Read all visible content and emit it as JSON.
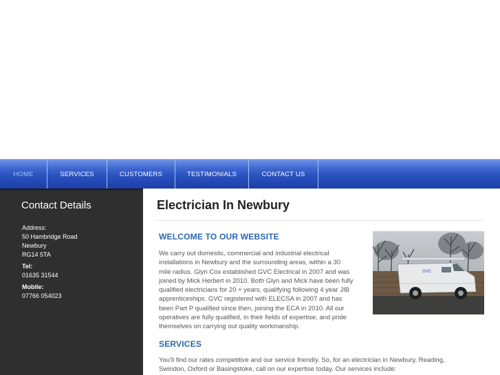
{
  "nav": {
    "items": [
      {
        "label": "HOME",
        "active": true
      },
      {
        "label": "SERVICES",
        "active": false
      },
      {
        "label": "CUSTOMERS",
        "active": false
      },
      {
        "label": "TESTIMONIALS",
        "active": false
      },
      {
        "label": "CONTACT US",
        "active": false
      }
    ]
  },
  "sidebar": {
    "title": "Contact Details",
    "address_label": "Address:",
    "address_lines": [
      "50 Hambridge Road",
      "Newbury",
      "RG14 5TA"
    ],
    "tel_label": "Tel:",
    "tel": "01635 31544",
    "mobile_label": "Mobile:",
    "mobile": "07766 054023"
  },
  "main": {
    "title": "Electrician In Newbury",
    "welcome_heading": "WELCOME TO OUR WEBSITE",
    "welcome_lines": [
      "We carry out domestic, commercial and industrial electrical",
      "installations in Newbury and the surrounding areas, within a 30",
      "mile radius. Glyn Cox established GVC Electrical in 2007 and was",
      "joined by Mick Herbert in 2010. Both Glyn and Mick have been fully",
      "qualified electricians for 20 + years, qualifying following 4 year JIB",
      "apprenticeships. GVC registered with ELECSA in 2007 and has",
      "been Part P qualified since then, joining the ECA in 2010. All our",
      "operatives are fully qualified, in their fields of expertise, and pride",
      "themselves on carrying out quality workmanship."
    ],
    "services_heading": "SERVICES",
    "services_lines": [
      "You'll find our rates competitive and our service friendly. So, for an electrician in Newbury, Reading,",
      "Swindon, Oxford or Basingstoke, call on our expertise today. Our services include:"
    ],
    "photo": {
      "van_text": "GVC"
    }
  },
  "colors": {
    "nav_blue": "#2a52bf",
    "sidebar_bg": "#2f2f2f",
    "heading_blue": "#2a66b0"
  }
}
